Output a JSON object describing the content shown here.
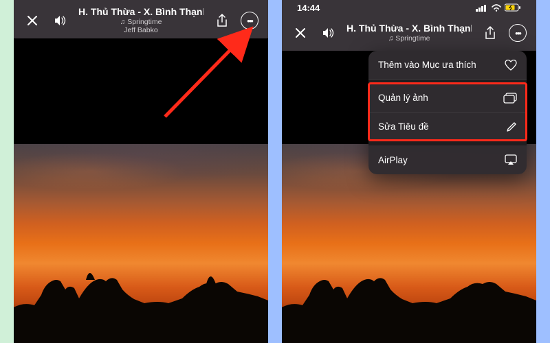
{
  "left": {
    "title": "H. Thủ Thừa - X. Bình Thạnh",
    "song": "♫ Springtime",
    "artist": "Jeff Babko"
  },
  "right": {
    "time": "14:44",
    "title": "H. Thủ Thừa - X. Bình Thạnh",
    "song": "♫ Springtime",
    "menu": {
      "favorite": "Thêm vào Mục ưa thích",
      "manage": "Quản lý ảnh",
      "edit_title": "Sửa Tiêu đề",
      "airplay": "AirPlay"
    }
  }
}
